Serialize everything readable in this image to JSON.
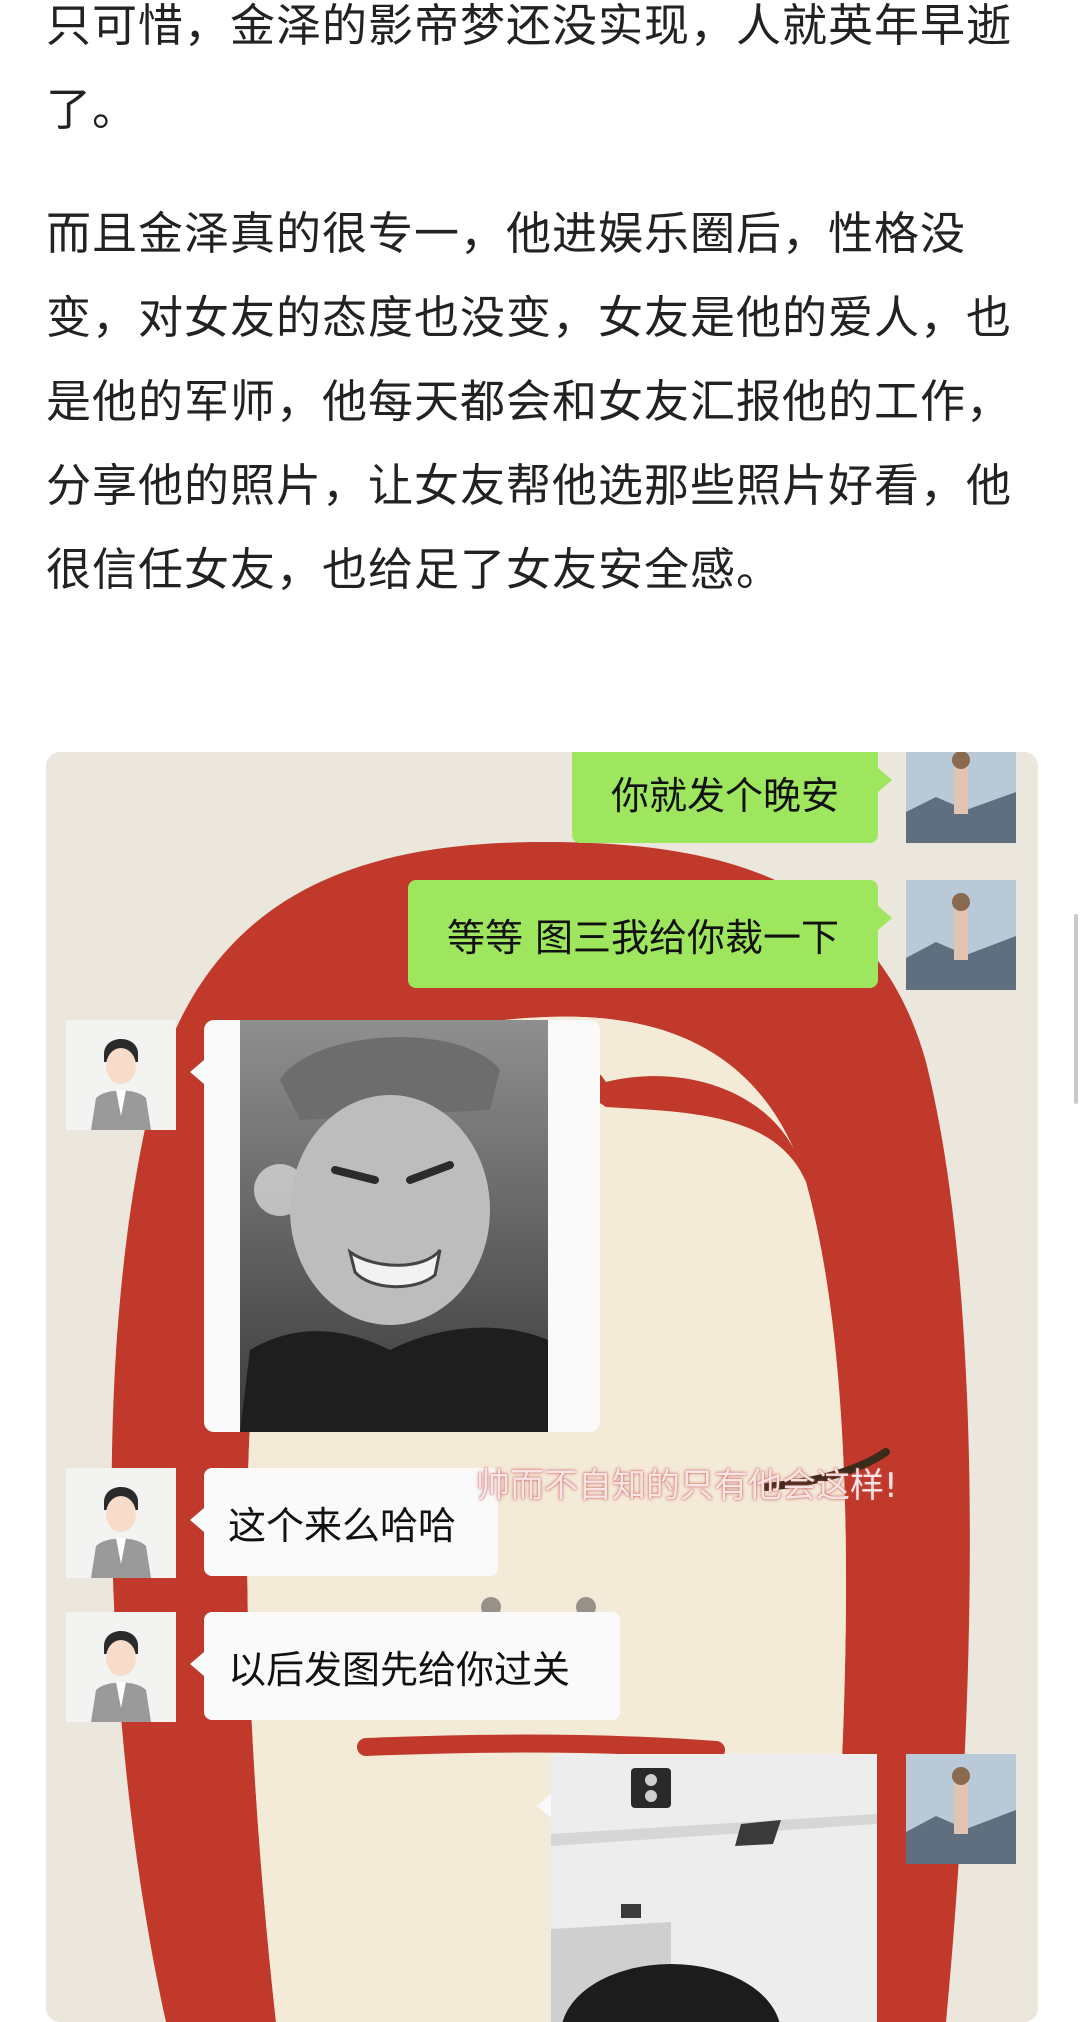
{
  "article": {
    "paragraphs": [
      "只可惜，金泽的影帝梦还没实现，人就英年早逝了。",
      "而且金泽真的很专一，他进娱乐圈后，性格没变，对女友的态度也没变，女友是他的爱人，也是他的军师，他每天都会和女友汇报他的工作，分享他的照片，让女友帮他选那些照片好看，他很信任女友，也给足了女友安全感。"
    ]
  },
  "chat_screenshot": {
    "messages": [
      {
        "side": "right",
        "type": "text",
        "text": "你就发个晚安"
      },
      {
        "side": "right",
        "type": "text",
        "text": "等等 图三我给你裁一下"
      },
      {
        "side": "left",
        "type": "image"
      },
      {
        "side": "left",
        "type": "text",
        "text": "这个来么哈哈"
      },
      {
        "side": "left",
        "type": "text",
        "text": "以后发图先给你过关"
      },
      {
        "side": "right",
        "type": "image"
      }
    ],
    "watermark": "帅而不自知的只有他会这样!",
    "colors": {
      "sent_bubble": "#9ee65e",
      "received_bubble": "#fafafa",
      "hair_illustration": "#c0392b",
      "background": "#ece7dc"
    }
  },
  "icons": [
    "male-avatar-icon",
    "female-avatar-icon"
  ]
}
